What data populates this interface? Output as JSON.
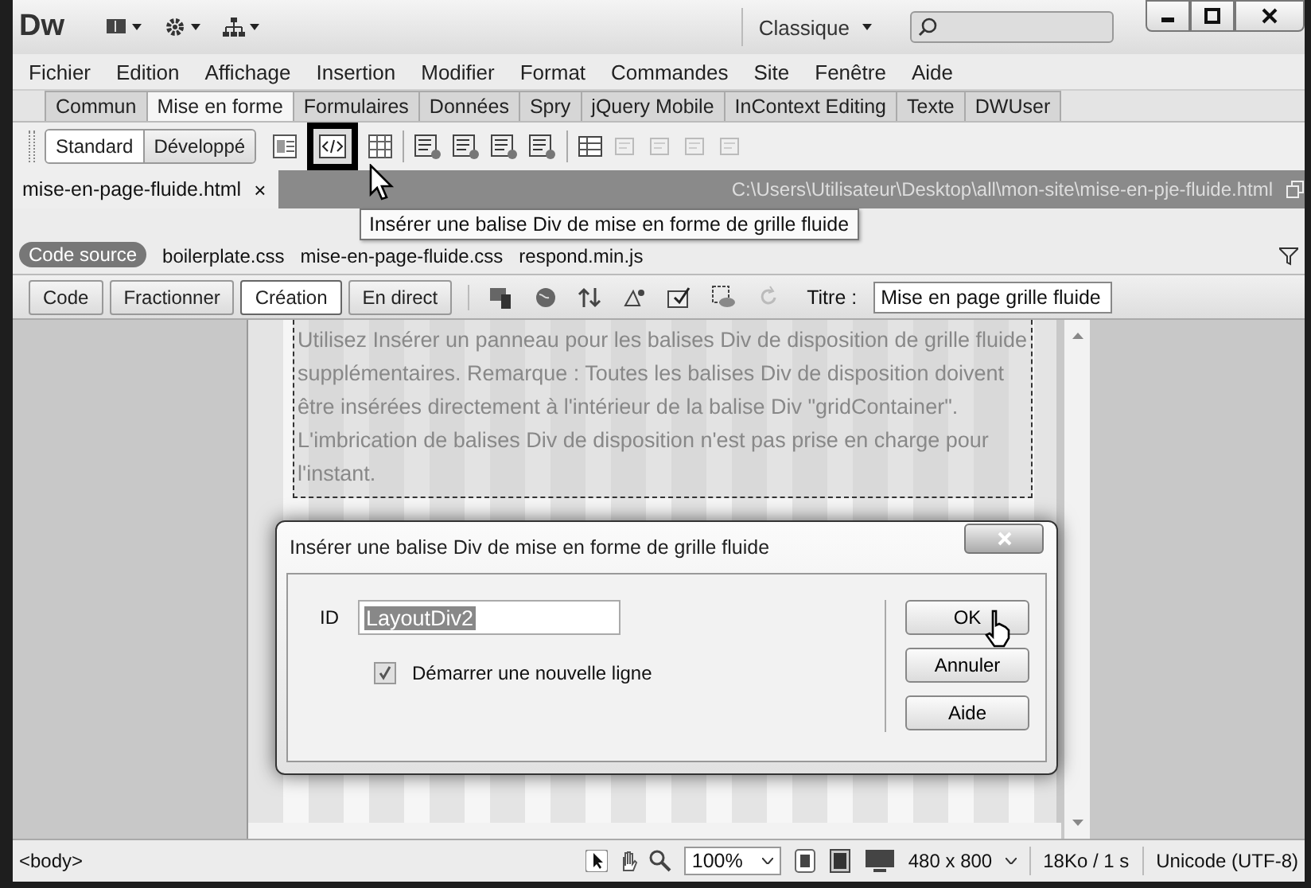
{
  "app": {
    "logo": "Dw",
    "workspace": "Classique"
  },
  "menu": [
    "Fichier",
    "Edition",
    "Affichage",
    "Insertion",
    "Modifier",
    "Format",
    "Commandes",
    "Site",
    "Fenêtre",
    "Aide"
  ],
  "insert_tabs": [
    {
      "label": "Commun",
      "selected": false
    },
    {
      "label": "Mise en forme",
      "selected": true
    },
    {
      "label": "Formulaires",
      "selected": false
    },
    {
      "label": "Données",
      "selected": false
    },
    {
      "label": "Spry",
      "selected": false
    },
    {
      "label": "jQuery Mobile",
      "selected": false
    },
    {
      "label": "InContext Editing",
      "selected": false
    },
    {
      "label": "Texte",
      "selected": false
    },
    {
      "label": "DWUser",
      "selected": false
    }
  ],
  "view_modes": [
    {
      "label": "Standard",
      "selected": true
    },
    {
      "label": "Développé",
      "selected": false
    }
  ],
  "tooltip": "Insérer une balise Div de mise en forme de grille fluide",
  "document_tab": {
    "label": "mise-en-page-fluide.html",
    "close": "×",
    "path": "C:\\Users\\Utilisateur\\Desktop\\all\\mon-site\\mise-en-pje-fluide.html"
  },
  "related_files": [
    {
      "label": "Code source",
      "selected": true
    },
    {
      "label": "boilerplate.css",
      "selected": false
    },
    {
      "label": "mise-en-page-fluide.css",
      "selected": false
    },
    {
      "label": "respond.min.js",
      "selected": false
    }
  ],
  "document_views": [
    {
      "label": "Code",
      "selected": false
    },
    {
      "label": "Fractionner",
      "selected": false
    },
    {
      "label": "Création",
      "selected": true
    },
    {
      "label": "En direct",
      "selected": false
    }
  ],
  "title_field": {
    "label": "Titre :",
    "value": "Mise en page grille fluide"
  },
  "canvas_text": "Utilisez Insérer un panneau pour les balises Div de disposition de grille fluide supplémentaires. Remarque : Toutes les balises Div de disposition doivent être insérées directement à l'intérieur de la balise Div \"gridContainer\". L'imbrication de balises Div de disposition n'est pas prise en charge pour l'instant.",
  "dialog": {
    "title": "Insérer une balise Div de mise en forme de grille fluide",
    "id_label": "ID",
    "id_value": "LayoutDiv2",
    "checkbox": {
      "label": "Démarrer une nouvelle ligne",
      "checked": true
    },
    "buttons": [
      "OK",
      "Annuler",
      "Aide"
    ]
  },
  "status_bar": {
    "tag": "<body>",
    "zoom": "100%",
    "size": "480 x 800",
    "file_info": "18Ko / 1 s",
    "encoding": "Unicode (UTF-8)"
  }
}
